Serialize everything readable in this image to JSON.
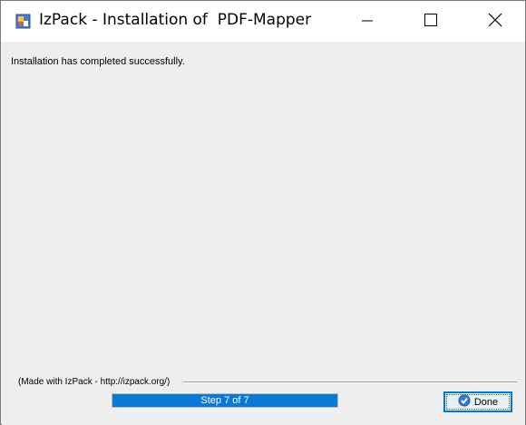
{
  "window": {
    "title": "IzPack - Installation of  PDF-Mapper",
    "icons": {
      "app": "izpack-app-icon",
      "minimize": "minimize-icon",
      "maximize": "maximize-icon",
      "close": "close-icon"
    }
  },
  "main": {
    "message": "Installation has completed successfully."
  },
  "footer": {
    "made_with": "(Made with IzPack - http://izpack.org/)",
    "progress": {
      "text": "Step 7 of 7",
      "current": 7,
      "total": 7,
      "fraction": 1.0,
      "color": "#0a78d7"
    },
    "done_label": "Done",
    "done_icon": "checkmark-icon"
  }
}
